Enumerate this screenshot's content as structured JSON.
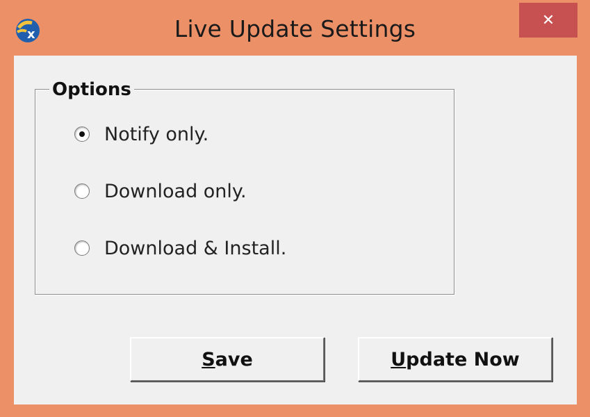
{
  "window": {
    "title": "Live Update Settings",
    "close_label": "✕",
    "icon": "app-logo-icon"
  },
  "options": {
    "group_label": "Options",
    "selected_index": 0,
    "items": [
      {
        "label": "Notify only.",
        "checked": true
      },
      {
        "label": "Download only.",
        "checked": false
      },
      {
        "label": "Download & Install.",
        "checked": false
      }
    ]
  },
  "buttons": {
    "save": {
      "mnemonic": "S",
      "rest": "ave"
    },
    "update_now": {
      "mnemonic": "U",
      "rest": "pdate Now"
    }
  },
  "colors": {
    "frame": "#ec9068",
    "close_button": "#c75050",
    "client_background": "#f0f0f0"
  }
}
